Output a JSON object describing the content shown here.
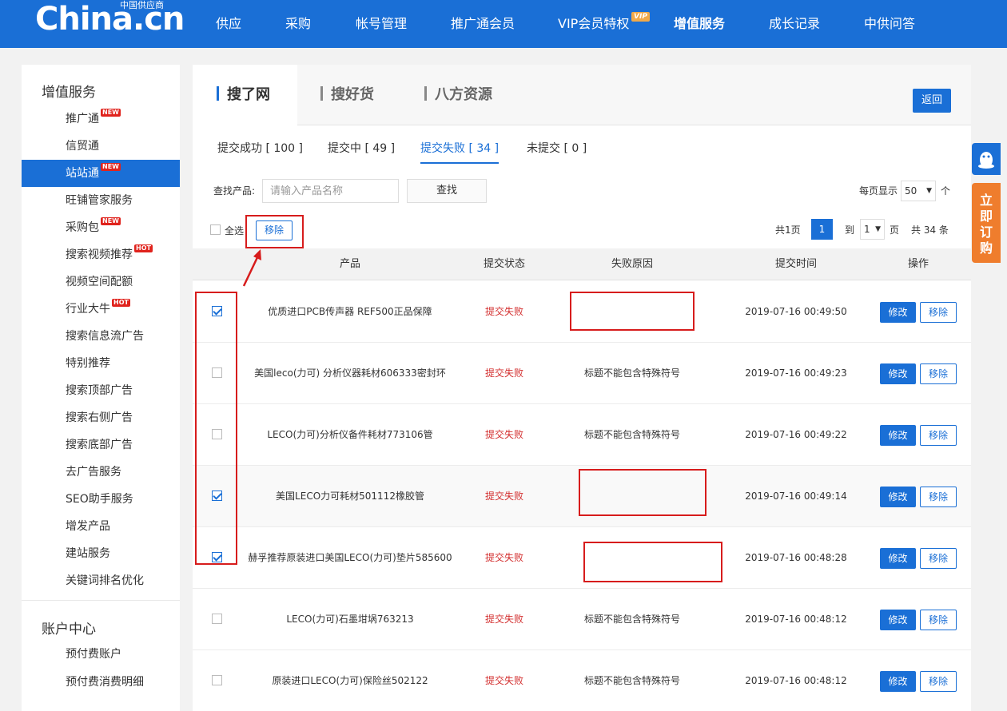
{
  "header": {
    "logo_text": "China.cn",
    "logo_sub": "中国供应商",
    "nav": [
      "供应",
      "采购",
      "帐号管理",
      "推广通会员",
      "VIP会员特权",
      "增值服务",
      "成长记录",
      "中供问答"
    ],
    "vip_badge": "VIP"
  },
  "sidebar": {
    "section1_title": "增值服务",
    "items": [
      {
        "label": "推广通",
        "badge": "NEW"
      },
      {
        "label": "信贸通"
      },
      {
        "label": "站站通",
        "badge": "NEW",
        "active": true
      },
      {
        "label": "旺铺管家服务"
      },
      {
        "label": "采购包",
        "badge": "NEW"
      },
      {
        "label": "搜索视频推荐",
        "badge": "HOT"
      },
      {
        "label": "视频空间配额"
      },
      {
        "label": "行业大牛",
        "badge": "HOT"
      },
      {
        "label": "搜索信息流广告"
      },
      {
        "label": "特别推荐"
      },
      {
        "label": "搜索顶部广告"
      },
      {
        "label": "搜索右侧广告"
      },
      {
        "label": "搜索底部广告"
      },
      {
        "label": "去广告服务"
      },
      {
        "label": "SEO助手服务"
      },
      {
        "label": "增发产品"
      },
      {
        "label": "建站服务"
      },
      {
        "label": "关键词排名优化"
      }
    ],
    "section2_title": "账户中心",
    "account_items": [
      "预付费账户",
      "预付费消费明细"
    ]
  },
  "main": {
    "big_tabs": [
      "搜了网",
      "搜好货",
      "八方资源"
    ],
    "back_label": "返回",
    "status_tabs": [
      "提交成功 [ 100 ]",
      "提交中 [ 49 ]",
      "提交失败 [ 34 ]",
      "未提交 [ 0 ]"
    ],
    "search": {
      "label": "查找产品:",
      "placeholder": "请输入产品名称",
      "button": "查找"
    },
    "per_page": {
      "label": "每页显示",
      "value": "50",
      "unit": "个"
    },
    "select_all_label": "全选",
    "bulk_remove_label": "移除",
    "pagination": {
      "total_pages": "共1页",
      "current": "1",
      "goto_label": "到",
      "goto_value": "1",
      "page_unit": "页",
      "total_items": "共 34 条"
    },
    "table": {
      "headers": [
        "产品",
        "提交状态",
        "失败原因",
        "提交时间",
        "操作"
      ],
      "edit_label": "修改",
      "remove_label": "移除",
      "rows": [
        {
          "checked": true,
          "product": "优质进口PCB传声器 REF500正品保障",
          "status": "提交失败",
          "reason": "",
          "time": "2019-07-16 00:49:50"
        },
        {
          "checked": false,
          "product": "美国leco(力可) 分析仪器耗材606333密封环",
          "status": "提交失败",
          "reason": "标题不能包含特殊符号",
          "time": "2019-07-16 00:49:23"
        },
        {
          "checked": false,
          "product": "LECO(力可)分析仪备件耗材773106管",
          "status": "提交失败",
          "reason": "标题不能包含特殊符号",
          "time": "2019-07-16 00:49:22"
        },
        {
          "checked": true,
          "product": "美国LECO力可耗材501112橡胶管",
          "status": "提交失败",
          "reason": "",
          "time": "2019-07-16 00:49:14"
        },
        {
          "checked": true,
          "product": "赫孚推荐原装进口美国LECO(力可)垫片585600",
          "status": "提交失败",
          "reason": "",
          "time": "2019-07-16 00:48:28"
        },
        {
          "checked": false,
          "product": "LECO(力可)石墨坩埚763213",
          "status": "提交失败",
          "reason": "标题不能包含特殊符号",
          "time": "2019-07-16 00:48:12"
        },
        {
          "checked": false,
          "product": "原装进口LECO(力可)保险丝502122",
          "status": "提交失败",
          "reason": "标题不能包含特殊符号",
          "time": "2019-07-16 00:48:12"
        }
      ]
    }
  },
  "float": {
    "order_label": "立即订购"
  },
  "colors": {
    "brand_blue": "#1a6fd6",
    "fail_red": "#d32f2f",
    "annotation_red": "#d71c1c",
    "order_orange": "#ef7d2d"
  }
}
